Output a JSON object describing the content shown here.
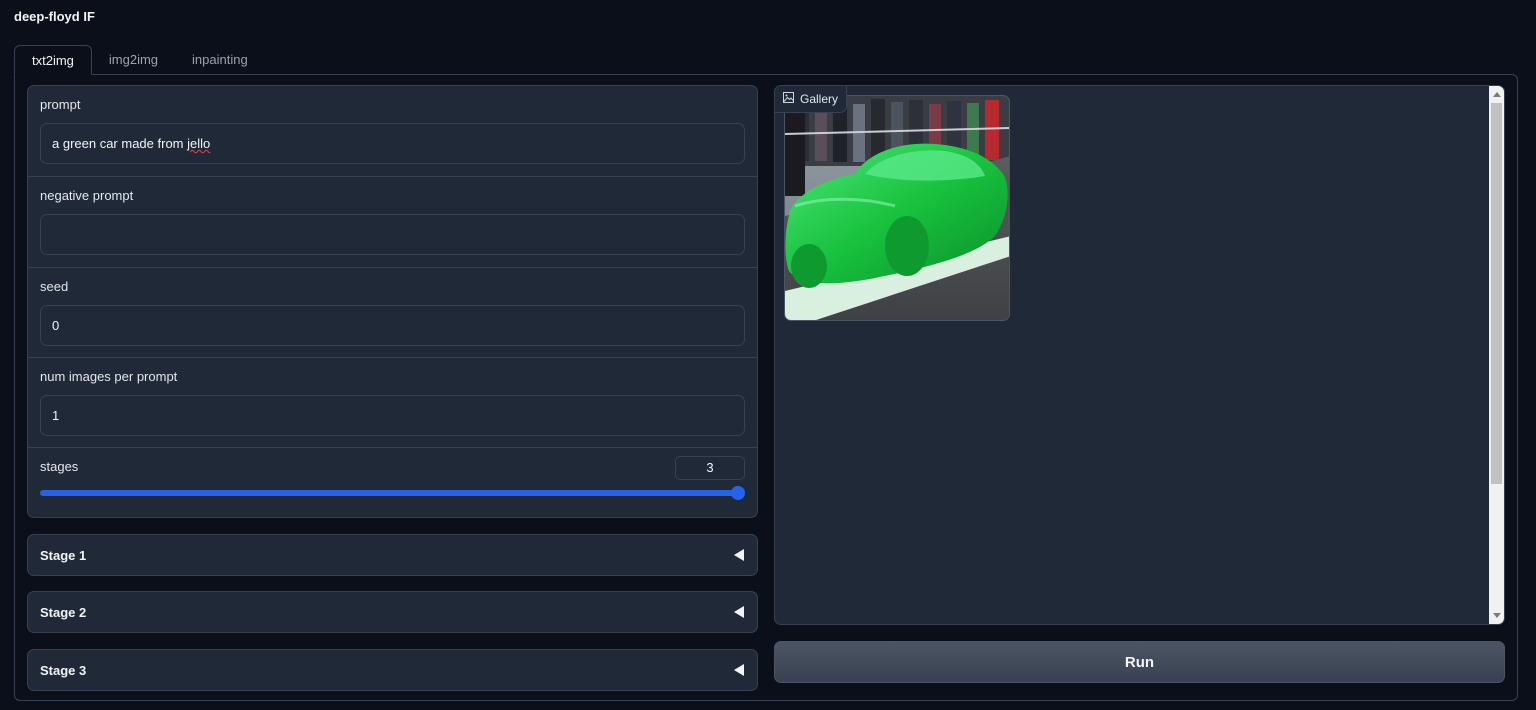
{
  "app": {
    "title": "deep-floyd IF"
  },
  "tabs": [
    {
      "label": "txt2img",
      "active": true
    },
    {
      "label": "img2img",
      "active": false
    },
    {
      "label": "inpainting",
      "active": false
    }
  ],
  "form": {
    "prompt": {
      "label": "prompt",
      "value": "a green car made from ",
      "value_misspelled": "jello"
    },
    "negative_prompt": {
      "label": "negative prompt",
      "value": ""
    },
    "seed": {
      "label": "seed",
      "value": "0"
    },
    "num_images": {
      "label": "num images per prompt",
      "value": "1"
    },
    "stages": {
      "label": "stages",
      "value": "3",
      "level": 1.0
    }
  },
  "accordions": [
    {
      "label": "Stage 1"
    },
    {
      "label": "Stage 2"
    },
    {
      "label": "Stage 3"
    }
  ],
  "gallery": {
    "label": "Gallery"
  },
  "run_button": {
    "label": "Run"
  },
  "colors": {
    "accent": "#2563eb",
    "background": "#0b0f19",
    "panel": "#1f2937",
    "border": "#374151"
  },
  "icons": {
    "gallery": "image-icon",
    "accordion": "caret-left-icon"
  }
}
